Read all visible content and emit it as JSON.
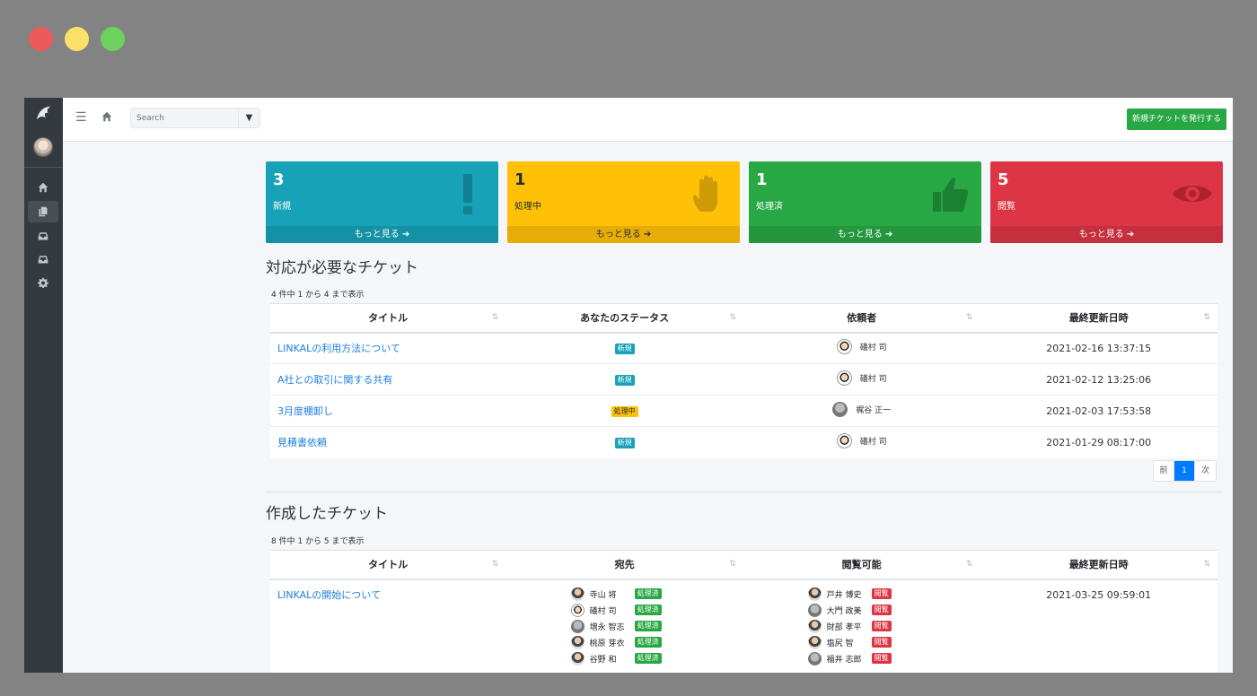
{
  "topbar": {
    "search_placeholder": "Search",
    "new_ticket_button": "新規チケットを発行する"
  },
  "sidebar": {
    "items": [
      {
        "icon": "home-icon"
      },
      {
        "icon": "copy-icon",
        "active": true
      },
      {
        "icon": "inbox-icon"
      },
      {
        "icon": "inbox-icon"
      },
      {
        "icon": "gear-icon"
      }
    ]
  },
  "cards": [
    {
      "count": "3",
      "label": "新規",
      "more": "もっと見る",
      "color": "#17a2b8",
      "icon": "exclamation-icon"
    },
    {
      "count": "1",
      "label": "処理中",
      "more": "もっと見る",
      "color": "#ffc107",
      "icon": "hand-icon"
    },
    {
      "count": "1",
      "label": "処理済",
      "more": "もっと見る",
      "color": "#28a745",
      "icon": "thumbs-up-icon"
    },
    {
      "count": "5",
      "label": "閲覧",
      "more": "もっと見る",
      "color": "#dc3545",
      "icon": "eye-icon"
    }
  ],
  "section1": {
    "title": "対応が必要なチケット",
    "info": "4 件中 1 から 4 まで表示",
    "headers": [
      "タイトル",
      "あなたのステータス",
      "依頼者",
      "最終更新日時"
    ],
    "rows": [
      {
        "title": "LINKALの利用方法について",
        "status": "新規",
        "requester": "礒村 司",
        "date": "2021-02-16 13:37:15"
      },
      {
        "title": "A社との取引に関する共有",
        "status": "新規",
        "requester": "礒村 司",
        "date": "2021-02-12 13:25:06"
      },
      {
        "title": "3月度棚卸し",
        "status": "処理中",
        "requester": "梶谷 正一",
        "date": "2021-02-03 17:53:58"
      },
      {
        "title": "見積書依頼",
        "status": "新規",
        "requester": "礒村 司",
        "date": "2021-01-29 08:17:00"
      }
    ],
    "pager": {
      "prev": "前",
      "page": "1",
      "next": "次"
    }
  },
  "section2": {
    "title": "作成したチケット",
    "info": "8 件中 1 から 5 まで表示",
    "headers": [
      "タイトル",
      "宛先",
      "閲覧可能",
      "最終更新日時"
    ],
    "row": {
      "title": "LINKALの開始について",
      "date": "2021-03-25 09:59:01",
      "recipients": [
        {
          "name": "寺山 将",
          "status": "処理済"
        },
        {
          "name": "礒村 司",
          "status": "処理済"
        },
        {
          "name": "増永 智志",
          "status": "処理済"
        },
        {
          "name": "桃原 芽衣",
          "status": "処理済"
        },
        {
          "name": "谷野 和",
          "status": "処理済"
        }
      ],
      "viewers": [
        {
          "name": "戸井 博史",
          "status": "閲覧"
        },
        {
          "name": "大門 政美",
          "status": "閲覧"
        },
        {
          "name": "財部 孝平",
          "status": "閲覧"
        },
        {
          "name": "塩尻 智",
          "status": "閲覧"
        },
        {
          "name": "福井 志郎",
          "status": "閲覧"
        }
      ]
    }
  }
}
